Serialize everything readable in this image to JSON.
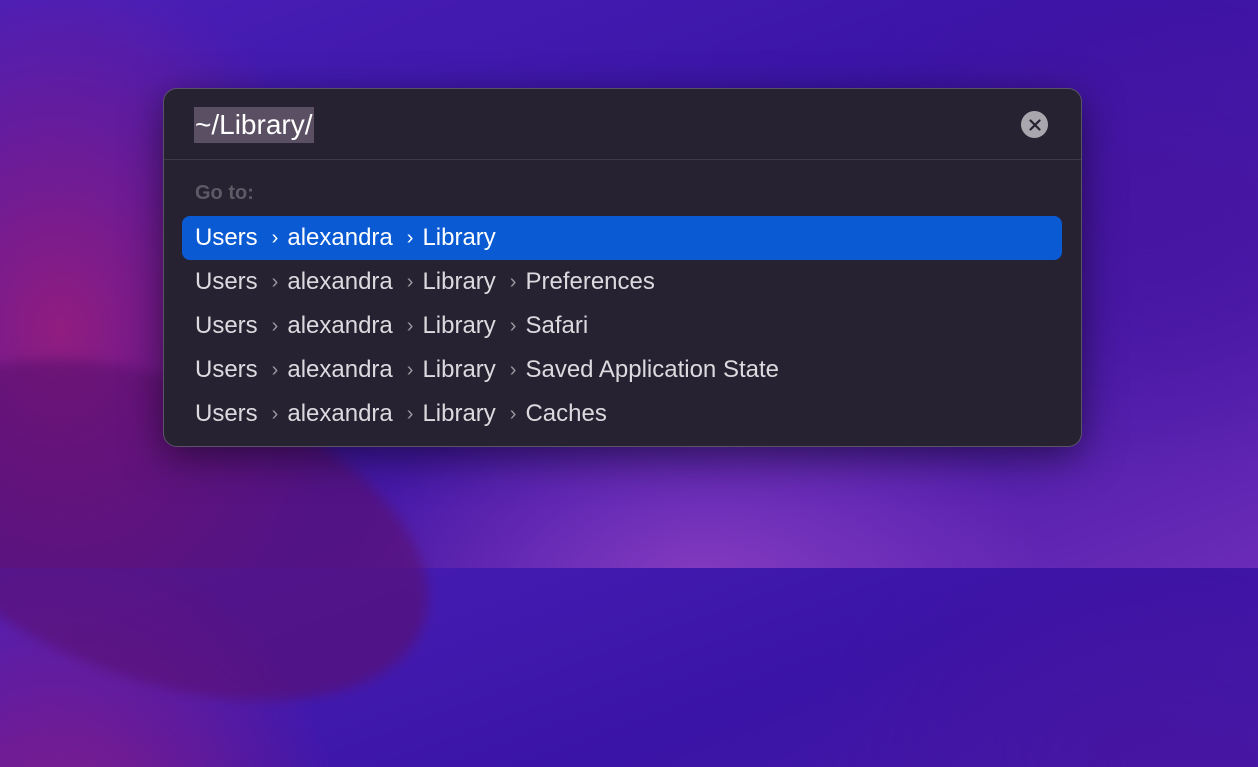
{
  "input": {
    "value": "~/Library/"
  },
  "clear_icon": "x-circle-icon",
  "section_label": "Go to:",
  "separator": "›",
  "colors": {
    "selection": "#0a5bd3",
    "panel": "#262231"
  },
  "results": [
    {
      "segments": [
        "Users",
        "alexandra",
        "Library"
      ],
      "selected": true
    },
    {
      "segments": [
        "Users",
        "alexandra",
        "Library",
        "Preferences"
      ],
      "selected": false
    },
    {
      "segments": [
        "Users",
        "alexandra",
        "Library",
        "Safari"
      ],
      "selected": false
    },
    {
      "segments": [
        "Users",
        "alexandra",
        "Library",
        "Saved Application State"
      ],
      "selected": false
    },
    {
      "segments": [
        "Users",
        "alexandra",
        "Library",
        "Caches"
      ],
      "selected": false
    }
  ]
}
